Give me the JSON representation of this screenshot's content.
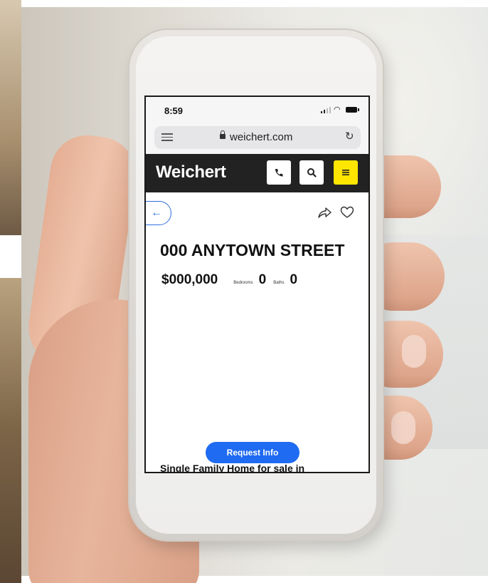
{
  "status_bar": {
    "time": "8:59"
  },
  "browser": {
    "url": "weichert.com"
  },
  "site_header": {
    "brand": "Weichert",
    "menu_button_color": "#ffe600",
    "header_color": "#222222",
    "icons": [
      "phone-icon",
      "search-icon",
      "hamburger-menu-icon"
    ]
  },
  "listing": {
    "address": "000 ANYTOWN STREET",
    "price": "$000,000",
    "bedrooms_label": "Bedrooms",
    "bedrooms": "0",
    "baths_label": "Baths",
    "baths": "0",
    "description_start": "Single Family Home for sale in"
  },
  "actions": {
    "request_info_label": "Request Info",
    "accent_color": "#1f6bf2",
    "icons": [
      "back-arrow-icon",
      "share-icon",
      "heart-icon"
    ]
  }
}
